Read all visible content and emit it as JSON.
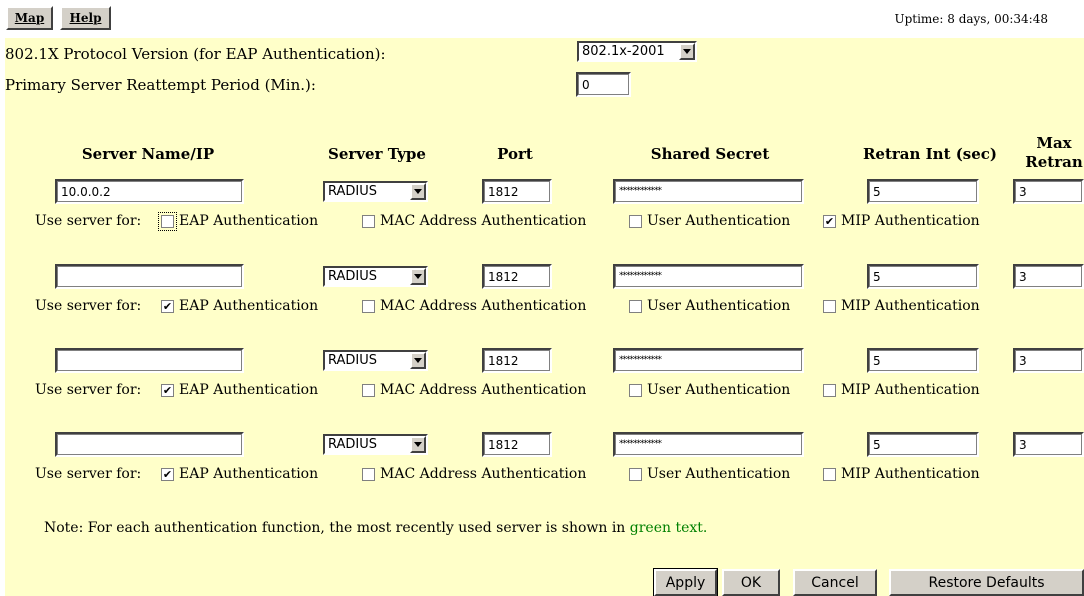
{
  "nav": {
    "map_label": "Map",
    "help_label": "Help"
  },
  "status": {
    "uptime": "Uptime: 8 days, 00:34:48"
  },
  "settings": {
    "protocol_label": "802.1X Protocol Version (for EAP Authentication):",
    "protocol_value": "802.1x-2001",
    "reattempt_label": "Primary Server Reattempt Period (Min.):",
    "reattempt_value": "0"
  },
  "table": {
    "headers": {
      "server": "Server Name/IP",
      "type": "Server Type",
      "port": "Port",
      "secret": "Shared Secret",
      "retran_int": "Retran Int (sec)",
      "max_retran_line1": "Max",
      "max_retran_line2": "Retran"
    },
    "use_for_label": "Use server for:",
    "auth_labels": {
      "eap": "EAP Authentication",
      "mac": "MAC Address Authentication",
      "user": "User Authentication",
      "mip": "MIP Authentication"
    },
    "servers": [
      {
        "name": "10.0.0.2",
        "type": "RADIUS",
        "port": "1812",
        "secret": "************",
        "retran_int": "5",
        "max_retran": "3",
        "eap": false,
        "mac": false,
        "user": false,
        "mip": true
      },
      {
        "name": "",
        "type": "RADIUS",
        "port": "1812",
        "secret": "************",
        "retran_int": "5",
        "max_retran": "3",
        "eap": true,
        "mac": false,
        "user": false,
        "mip": false
      },
      {
        "name": "",
        "type": "RADIUS",
        "port": "1812",
        "secret": "************",
        "retran_int": "5",
        "max_retran": "3",
        "eap": true,
        "mac": false,
        "user": false,
        "mip": false
      },
      {
        "name": "",
        "type": "RADIUS",
        "port": "1812",
        "secret": "************",
        "retran_int": "5",
        "max_retran": "3",
        "eap": true,
        "mac": false,
        "user": false,
        "mip": false
      }
    ]
  },
  "note": {
    "text": "Note: For each authentication function, the most recently used server is shown in",
    "highlight": "green text.",
    "highlight_color": "#008000"
  },
  "buttons": {
    "apply": "Apply",
    "ok": "OK",
    "cancel": "Cancel",
    "restore": "Restore Defaults"
  }
}
